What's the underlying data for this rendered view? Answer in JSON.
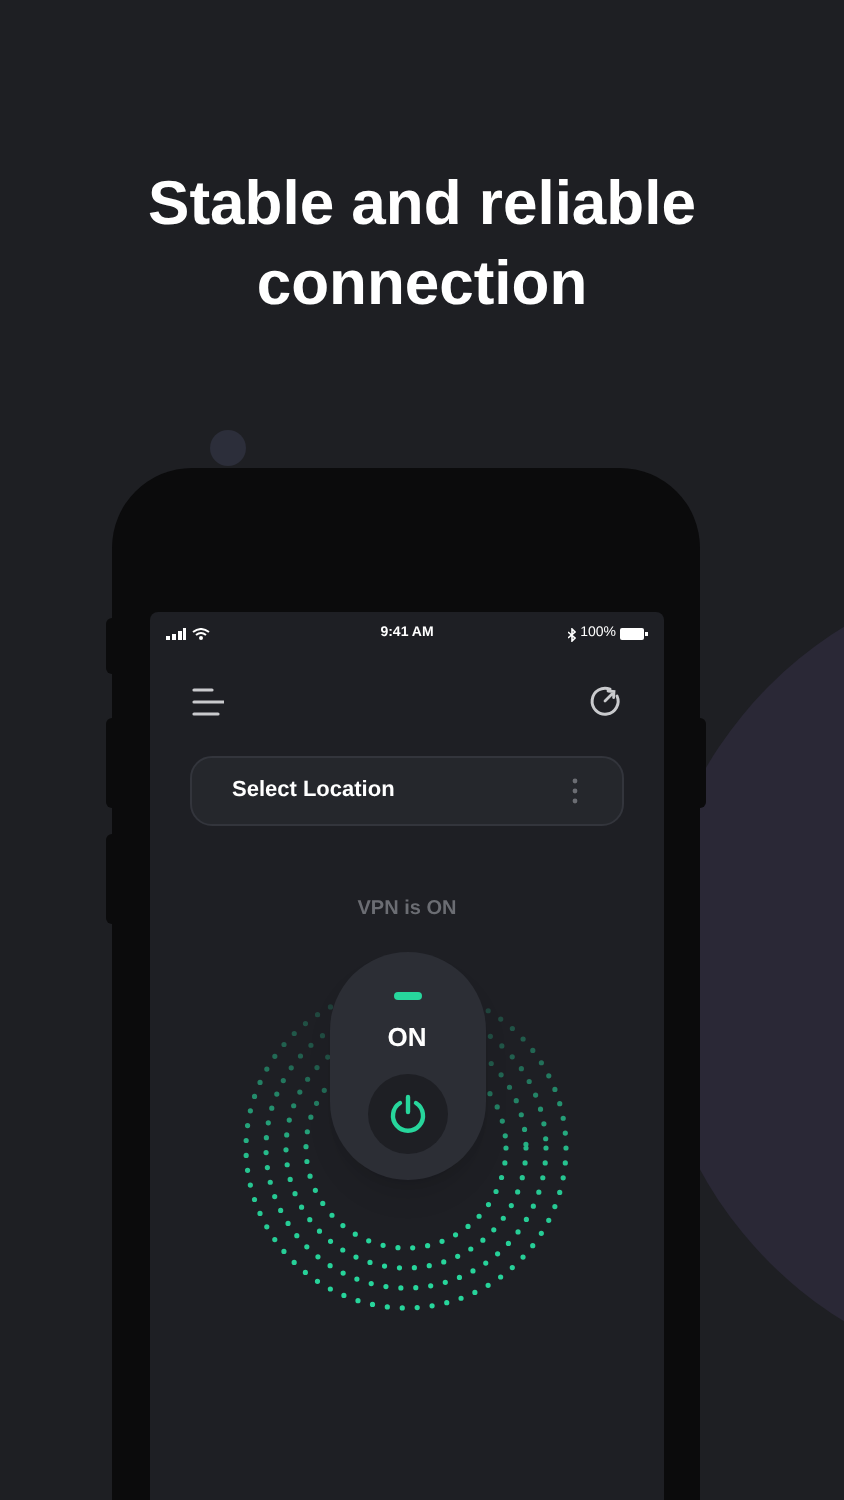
{
  "headline": "Stable and reliable connection",
  "status_bar": {
    "time": "9:41 AM",
    "battery": "100%"
  },
  "location_button": {
    "label": "Select Location"
  },
  "vpn_status": "VPN is ON",
  "toggle": {
    "label": "ON",
    "on": true
  }
}
